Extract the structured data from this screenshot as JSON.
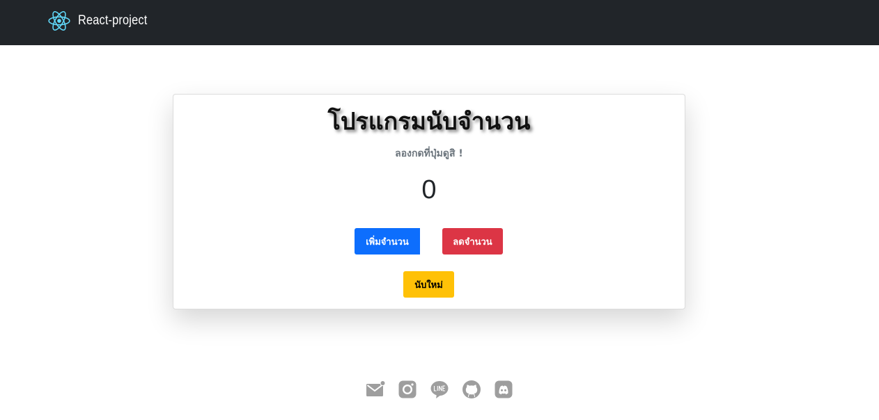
{
  "navbar": {
    "brand_text": "React-project",
    "logo_icon": "react-atom-icon",
    "background_color": "#212529",
    "logo_color": "#61dafb"
  },
  "counter": {
    "title": "โปรแกรมนับจำนวน",
    "subtitle": "ลองกดที่ปุ่มดูสิ !",
    "value": "0",
    "increase_label": "เพิ่มจำนวน",
    "decrease_label": "ลดจำนวน",
    "reset_label": "นับใหม่"
  },
  "colors": {
    "increase": "#0d6efd",
    "decrease": "#dc3545",
    "reset": "#ffc107",
    "footer_icons": "#9e9e9e"
  },
  "footer": {
    "icons": [
      "email-icon",
      "instagram-icon",
      "line-icon",
      "github-icon",
      "discord-icon"
    ]
  }
}
